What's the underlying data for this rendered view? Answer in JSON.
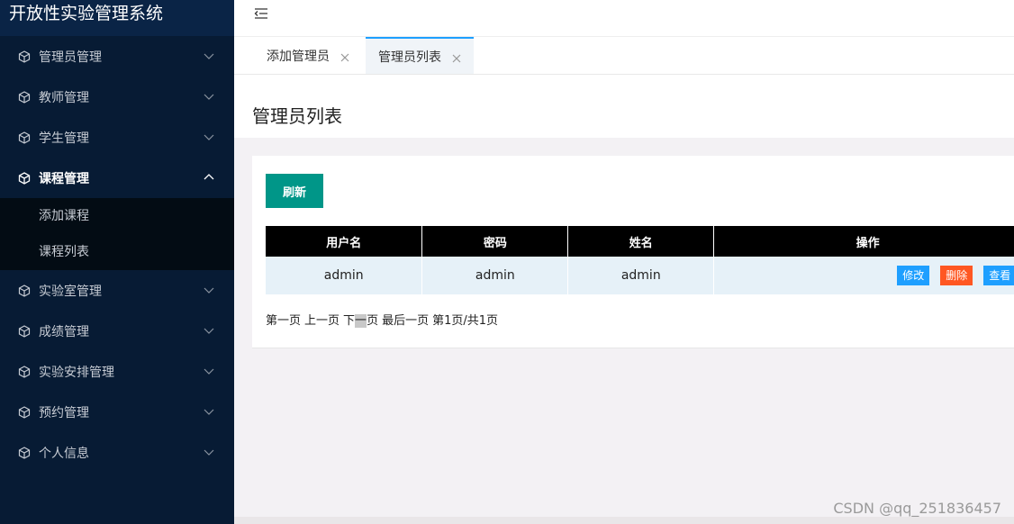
{
  "app": {
    "title": "开放性实验管理系统"
  },
  "sidebar": {
    "items": [
      {
        "label": "管理员管理"
      },
      {
        "label": "教师管理"
      },
      {
        "label": "学生管理"
      },
      {
        "label": "课程管理",
        "expanded": true,
        "children": [
          {
            "label": "添加课程"
          },
          {
            "label": "课程列表"
          }
        ]
      },
      {
        "label": "实验室管理"
      },
      {
        "label": "成绩管理"
      },
      {
        "label": "实验安排管理"
      },
      {
        "label": "预约管理"
      },
      {
        "label": "个人信息"
      }
    ]
  },
  "tabs": [
    {
      "label": "添加管理员",
      "active": false
    },
    {
      "label": "管理员列表",
      "active": true
    }
  ],
  "page": {
    "title": "管理员列表"
  },
  "toolbar": {
    "refresh_label": "刷新"
  },
  "table": {
    "headers": [
      "用户名",
      "密码",
      "姓名",
      "操作"
    ],
    "rows": [
      {
        "username": "admin",
        "password": "admin",
        "name": "admin"
      }
    ],
    "actions": {
      "edit": "修改",
      "delete": "删除",
      "view": "查看"
    }
  },
  "pager": {
    "first": "第一页",
    "prev": "上一页",
    "next_a": "下",
    "next_b": "一",
    "next_c": "页",
    "last": "最后一页",
    "info": "第1页/共1页"
  },
  "watermark": "CSDN @qq_251836457",
  "colors": {
    "sidebar": "#071b34",
    "primary": "#009688",
    "blue": "#1e9fff",
    "danger": "#ff5722"
  }
}
